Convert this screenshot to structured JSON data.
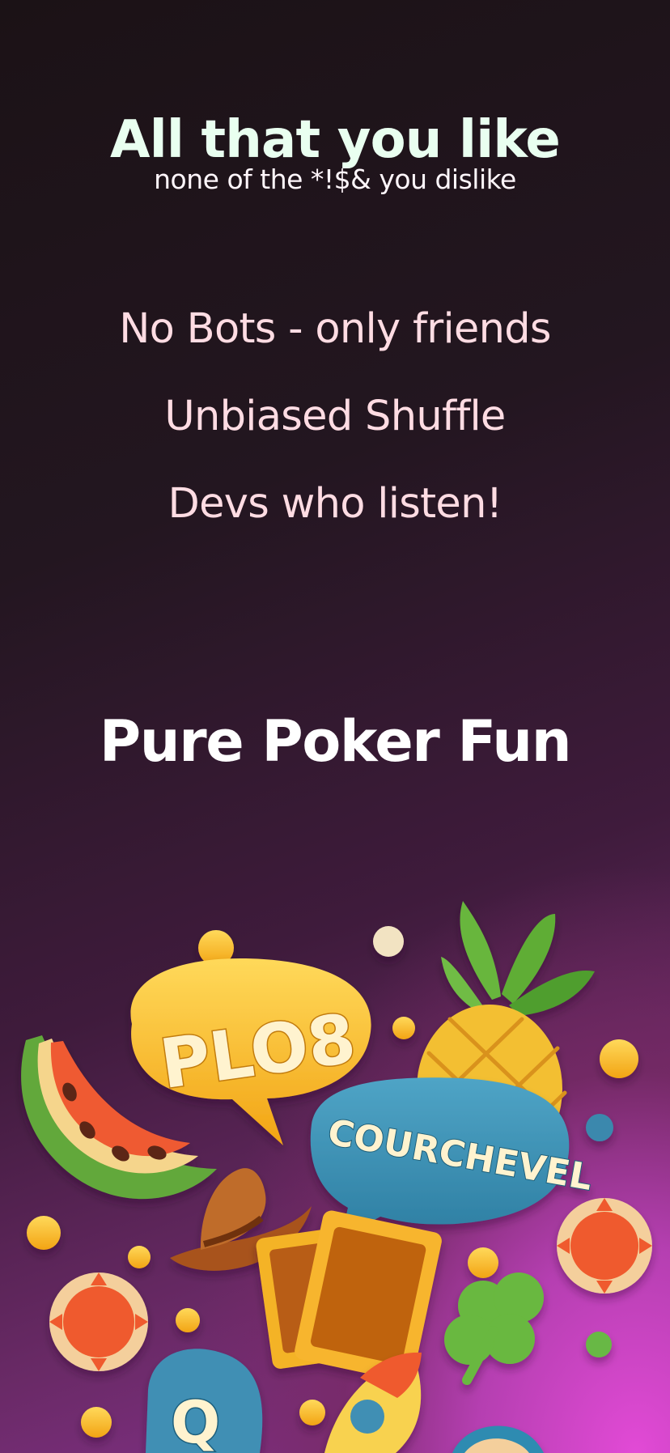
{
  "hero": {
    "headline": "All that you like",
    "subline": "none of the *!$& you dislike"
  },
  "features": [
    "No Bots - only friends",
    "Unbiased Shuffle",
    "Devs who listen!"
  ],
  "tagline": "Pure Poker Fun",
  "illustration": {
    "bubble_left": "PLO8",
    "bubble_right": "COURCHEVEL",
    "icon_letter": "Q",
    "icons": [
      "watermelon-icon",
      "pineapple-icon",
      "cowboy-hat-icon",
      "playing-card-icon",
      "poker-chip-icon",
      "clover-icon",
      "rocket-icon"
    ]
  },
  "colors": {
    "headline": "#e9fff0",
    "features": "#ffdce3",
    "tagline": "#ffffff",
    "background_top": "#1b1216",
    "background_bottom": "#e24ad6"
  }
}
